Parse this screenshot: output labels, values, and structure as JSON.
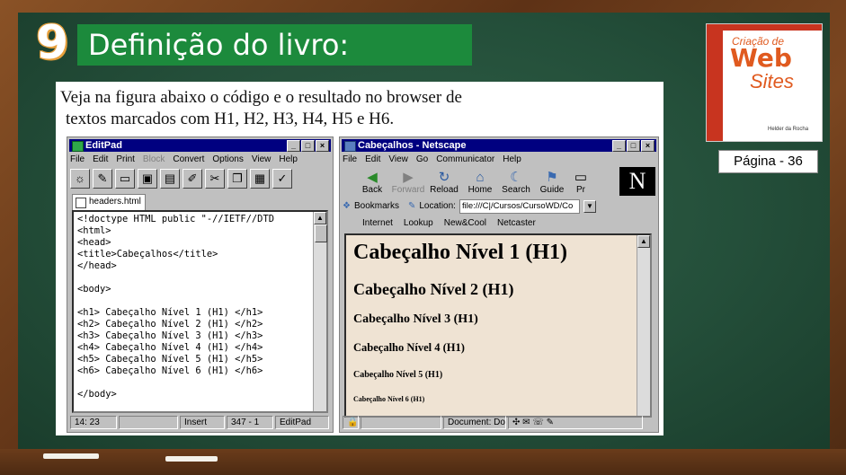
{
  "slide": {
    "number": "9",
    "title": "Definição do livro:",
    "caption_line1": "Veja na figura abaixo o código e o resultado no browser de",
    "caption_line2": "textos marcados com H1, H2, H3, H4, H5 e H6.",
    "page_label": "Página - 36"
  },
  "book_cover": {
    "title_line1": "Criação de",
    "title_line2": "Web",
    "title_line3": "Sites",
    "author": "Helder da Rocha"
  },
  "editpad": {
    "title": "EditPad",
    "menu": [
      "File",
      "Edit",
      "Print",
      "Block",
      "Convert",
      "Options",
      "View",
      "Help"
    ],
    "menu_disabled_index": 3,
    "tab_label": "headers.html",
    "code_lines": [
      "<!doctype HTML public \"-//IETF//DTD",
      "<html>",
      "<head>",
      "<title>Cabeçalhos</title>",
      "</head>",
      "",
      "<body>",
      "",
      "<h1> Cabeçalho Nível 1 (H1) </h1>",
      "<h2> Cabeçalho Nível 2 (H1) </h2>",
      "<h3> Cabeçalho Nível 3 (H1) </h3>",
      "<h4> Cabeçalho Nível 4 (H1) </h4>",
      "<h5> Cabeçalho Nível 5 (H1) </h5>",
      "<h6> Cabeçalho Nível 6 (H1) </h6>",
      "",
      "</body>"
    ],
    "status": {
      "position": "14: 23",
      "mode": "Insert",
      "count": "347 - 1",
      "app": "EditPad"
    }
  },
  "netscape": {
    "title": "Cabeçalhos - Netscape",
    "menu": [
      "File",
      "Edit",
      "View",
      "Go",
      "Communicator",
      "Help"
    ],
    "nav_buttons": [
      "Back",
      "Forward",
      "Reload",
      "Home",
      "Search",
      "Guide",
      "Pr"
    ],
    "bookmarks_label": "Bookmarks",
    "location_label": "Location:",
    "location_value": "file:///C|/Cursos/CursoWD/Co",
    "personal_buttons": [
      "Internet",
      "Lookup",
      "New&Cool",
      "Netcaster"
    ],
    "headings": [
      "Cabeçalho Nível 1 (H1)",
      "Cabeçalho Nível 2 (H1)",
      "Cabeçalho Nível 3 (H1)",
      "Cabeçalho Nível 4 (H1)",
      "Cabeçalho Nível 5 (H1)",
      "Cabeçalho Nível 6 (H1)"
    ],
    "status_text": "Document: Do"
  }
}
